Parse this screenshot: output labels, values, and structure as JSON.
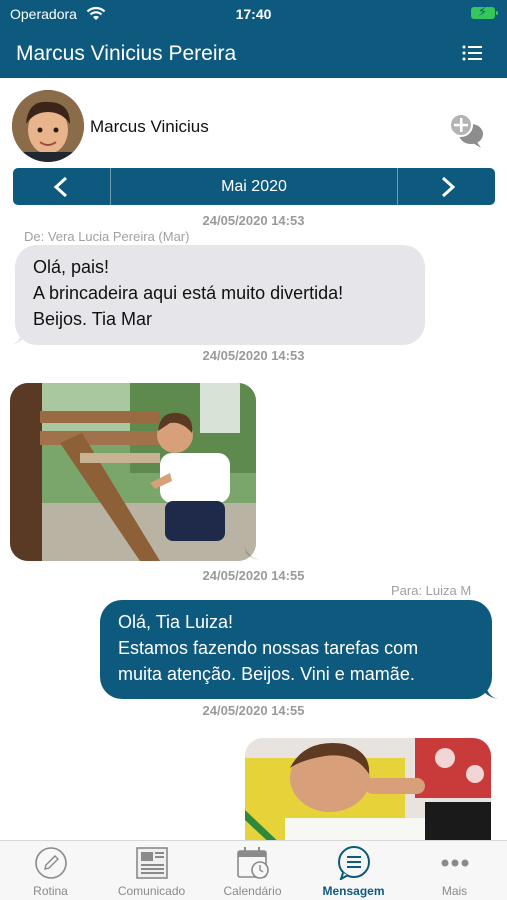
{
  "status_bar": {
    "carrier": "Operadora",
    "time": "17:40"
  },
  "header": {
    "title": "Marcus Vinicius Pereira",
    "menu_icon": "list-icon"
  },
  "profile": {
    "name": "Marcus Vinicius",
    "action_icon": "new-chat-icon"
  },
  "month_nav": {
    "label": "Mai 2020",
    "prev_icon": "chevron-left-icon",
    "next_icon": "chevron-right-icon"
  },
  "messages": [
    {
      "timestamp": "24/05/2020 14:53",
      "meta": "De: Vera Lucia Pereira (Mar)",
      "direction": "in",
      "type": "text",
      "lines": [
        "Olá, pais!",
        "A brincadeira aqui está muito divertida!",
        "Beijos. Tia Mar"
      ]
    },
    {
      "timestamp": "24/05/2020 14:53",
      "direction": "in",
      "type": "image",
      "image": "child-on-playground-photo"
    },
    {
      "timestamp": "24/05/2020 14:55",
      "meta": "Para: Luiza M",
      "direction": "out",
      "type": "text",
      "lines": [
        "Olá, Tia Luiza!",
        "Estamos fazendo nossas tarefas com",
        "muita atenção. Beijos. Vini e mamãe."
      ]
    },
    {
      "timestamp": "24/05/2020 14:55",
      "direction": "out",
      "type": "image",
      "image": "child-drawing-photo"
    }
  ],
  "tabbar": {
    "tabs": [
      {
        "label": "Rotina",
        "icon": "pencil-icon",
        "active": false
      },
      {
        "label": "Comunicado",
        "icon": "newspaper-icon",
        "active": false
      },
      {
        "label": "Calendário",
        "icon": "calendar-icon",
        "active": false
      },
      {
        "label": "Mensagem",
        "icon": "message-icon",
        "active": true
      },
      {
        "label": "Mais",
        "icon": "more-icon",
        "active": false
      }
    ]
  },
  "colors": {
    "primary": "#0e5a7f",
    "incoming_bubble": "#e6e6ea",
    "timestamp": "#9a9a9a",
    "battery": "#35c759"
  }
}
